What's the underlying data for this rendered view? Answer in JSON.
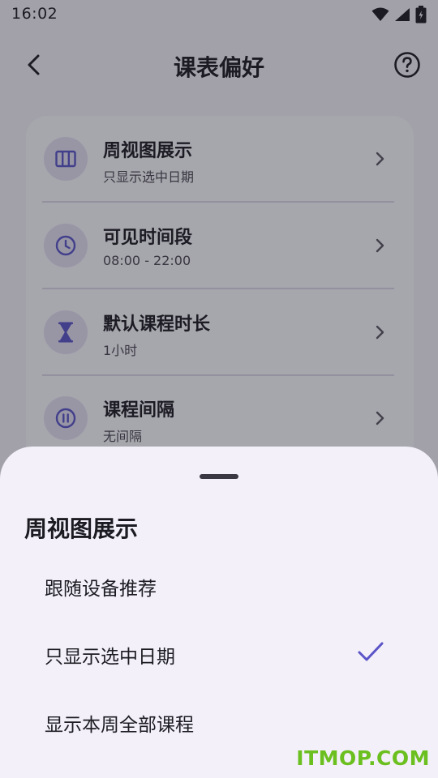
{
  "status_bar": {
    "time": "16:02"
  },
  "app_bar": {
    "title": "课表偏好",
    "icons": {
      "back": "back-arrow-icon",
      "help": "help-circle-icon"
    }
  },
  "settings": {
    "items": [
      {
        "title": "周视图展示",
        "subtitle": "只显示选中日期",
        "icon": "columns-icon"
      },
      {
        "title": "可见时间段",
        "subtitle": "08:00 - 22:00",
        "icon": "clock-icon"
      },
      {
        "title": "默认课程时长",
        "subtitle": "1小时",
        "icon": "hourglass-icon"
      },
      {
        "title": "课程间隔",
        "subtitle": "无间隔",
        "icon": "pause-circle-icon"
      }
    ]
  },
  "sheet": {
    "title": "周视图展示",
    "options": [
      {
        "label": "跟随设备推荐",
        "selected": false
      },
      {
        "label": "只显示选中日期",
        "selected": true
      },
      {
        "label": "显示本周全部课程",
        "selected": false
      }
    ]
  },
  "watermark": "ITMOP.COM",
  "colors": {
    "accent": "#5a54c8",
    "icon_bg": "#e4e1f3",
    "sheet_bg": "#f3f0f9",
    "text_primary": "#1c1b22"
  }
}
